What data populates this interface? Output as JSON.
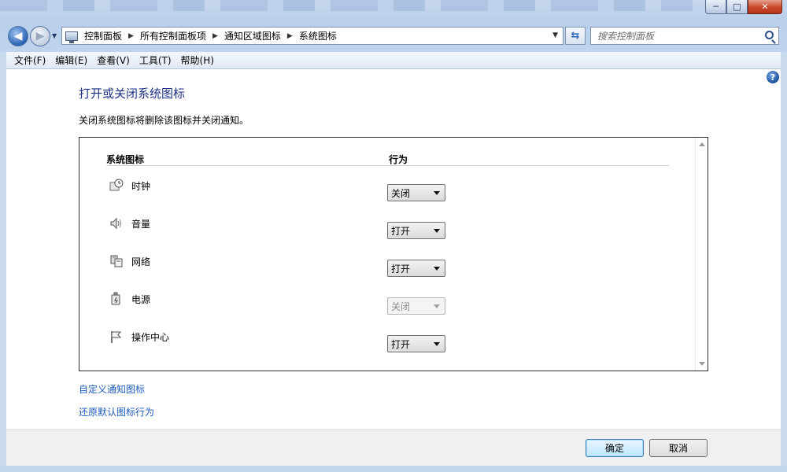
{
  "window": {
    "minimize": "─",
    "maximize": "□",
    "close": "✕"
  },
  "address": {
    "crumbs": [
      "控制面板",
      "所有控制面板项",
      "通知区域图标",
      "系统图标"
    ]
  },
  "search": {
    "placeholder": "搜索控制面板"
  },
  "menu": [
    "文件(F)",
    "编辑(E)",
    "查看(V)",
    "工具(T)",
    "帮助(H)"
  ],
  "page": {
    "title": "打开或关闭系统图标",
    "description": "关闭系统图标将删除该图标并关闭通知。",
    "help": "?"
  },
  "table": {
    "col_icon": "系统图标",
    "col_behavior": "行为",
    "rows": [
      {
        "icon": "clock-icon",
        "label": "时钟",
        "value": "关闭",
        "enabled": true
      },
      {
        "icon": "volume-icon",
        "label": "音量",
        "value": "打开",
        "enabled": true
      },
      {
        "icon": "network-icon",
        "label": "网络",
        "value": "打开",
        "enabled": true
      },
      {
        "icon": "power-icon",
        "label": "电源",
        "value": "关闭",
        "enabled": false
      },
      {
        "icon": "flag-icon",
        "label": "操作中心",
        "value": "打开",
        "enabled": true
      }
    ]
  },
  "links": {
    "customize": "自定义通知图标",
    "restore": "还原默认图标行为"
  },
  "buttons": {
    "ok": "确定",
    "cancel": "取消"
  }
}
